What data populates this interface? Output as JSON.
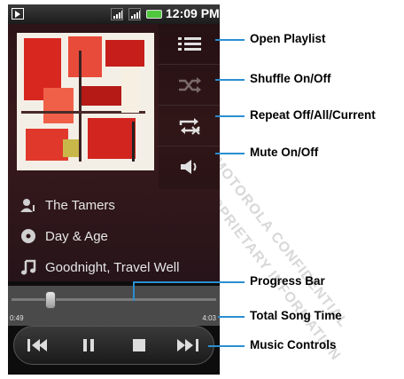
{
  "status_bar": {
    "time": "12:09 PM"
  },
  "track_info": {
    "artist": "The Tamers",
    "album": "Day & Age",
    "song": "Goodnight, Travel Well"
  },
  "progress": {
    "elapsed": "0:49",
    "total": "4:03",
    "fraction": 0.2
  },
  "side_buttons": [
    {
      "icon": "playlist-icon"
    },
    {
      "icon": "shuffle-icon"
    },
    {
      "icon": "repeat-icon"
    },
    {
      "icon": "speaker-icon"
    }
  ],
  "controls": [
    {
      "icon": "previous-icon"
    },
    {
      "icon": "pause-icon"
    },
    {
      "icon": "stop-icon"
    },
    {
      "icon": "next-icon"
    }
  ],
  "callouts": {
    "open_playlist": "Open Playlist",
    "shuffle": "Shuffle On/Off",
    "repeat": "Repeat Off/All/Current",
    "mute": "Mute On/Off",
    "progress_bar": "Progress Bar",
    "total_song_time": "Total Song Time",
    "music_controls": "Music Controls"
  },
  "watermark": {
    "line1": "MOTOROLA CONFIDENTIAL",
    "line2": "PROPRIETARY INFORMATION"
  },
  "colors": {
    "callout_line": "#2a8fd0",
    "battery": "#4fc83d",
    "accent_red": "#d9302a"
  }
}
